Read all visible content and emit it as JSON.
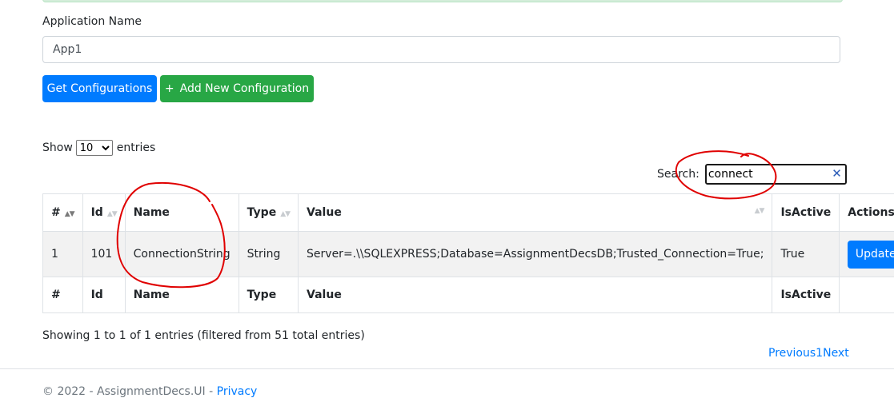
{
  "form": {
    "app_name_label": "Application Name",
    "app_name_value": "App1",
    "get_button": "Get Configurations",
    "add_button": "Add New Configuration",
    "add_button_icon": "+"
  },
  "table_controls": {
    "show_prefix": "Show",
    "entries_value": "10",
    "show_suffix": "entries",
    "search_label": "Search:",
    "search_value": "connect",
    "clear_icon": "✕"
  },
  "table": {
    "headers": [
      "#",
      "Id",
      "Name",
      "Type",
      "Value",
      "IsActive",
      "Actions"
    ],
    "footer_headers": [
      "#",
      "Id",
      "Name",
      "Type",
      "Value",
      "IsActive",
      ""
    ],
    "rows": [
      {
        "num": "1",
        "id": "101",
        "name": "ConnectionString",
        "type": "String",
        "value": "Server=.\\\\SQLEXPRESS;Database=AssignmentDecsDB;Trusted_Connection=True;",
        "is_active": "True",
        "action_label": "Update"
      }
    ]
  },
  "info_text": "Showing 1 to 1 of 1 entries (filtered from 51 total entries)",
  "pagination": {
    "previous": "Previous",
    "page": "1",
    "next": "Next"
  },
  "footer": {
    "copyright": "© 2022 - AssignmentDecs.UI - ",
    "privacy_link": "Privacy"
  },
  "colors": {
    "primary": "#007bff",
    "success": "#28a745",
    "annotation": "#e00000"
  }
}
